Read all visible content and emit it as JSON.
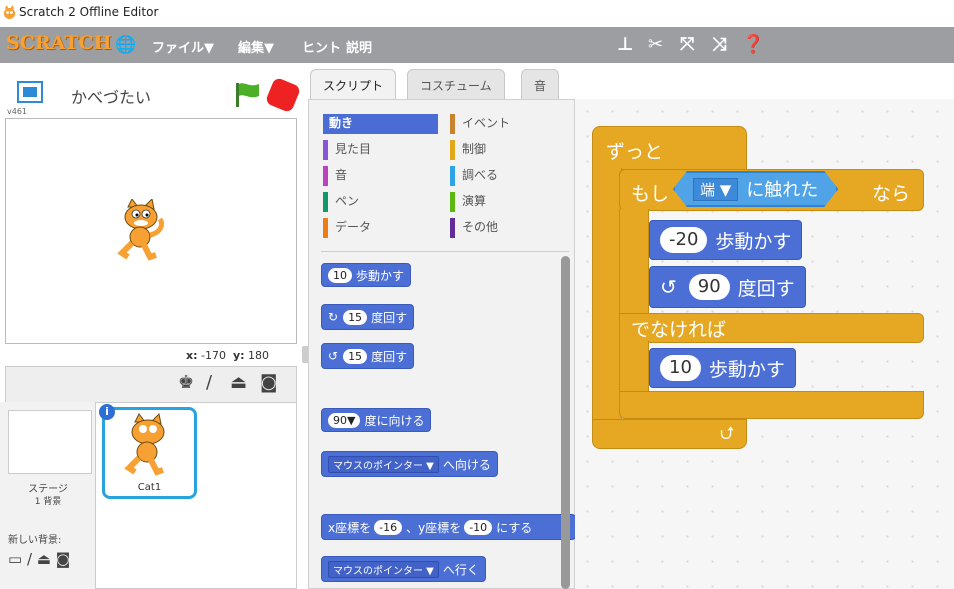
{
  "window": {
    "title": "Scratch 2 Offline Editor"
  },
  "menubar": {
    "logo": "SCRATCH",
    "file": "ファイル▼",
    "edit": "編集▼",
    "hint": "ヒント",
    "about": "説明"
  },
  "stage": {
    "project_name": "かべづたい",
    "version": "v461",
    "coords_x": "-170",
    "coords_y": "180",
    "x_label": "x:",
    "y_label": "y:"
  },
  "sprites": {
    "stage_label": "ステージ",
    "backdrop_count": "1 背景",
    "new_backdrop": "新しい背景:",
    "selected_sprite": "Cat1"
  },
  "tabs": [
    "スクリプト",
    "コスチューム",
    "音"
  ],
  "categories": {
    "left": [
      "動き",
      "見た目",
      "音",
      "ペン",
      "データ"
    ],
    "right": [
      "イベント",
      "制御",
      "調べる",
      "演算",
      "その他"
    ],
    "colors_left": [
      "#4a6cd4",
      "#8a55d7",
      "#bb42c3",
      "#0e9a6c",
      "#ee7d16"
    ],
    "colors_right": [
      "#c88330",
      "#e1a91a",
      "#2ca5e2",
      "#5cb712",
      "#632d99"
    ]
  },
  "palette_blocks": {
    "move": {
      "num": "10",
      "text": "歩動かす"
    },
    "turn_right": {
      "num": "15",
      "text": "度回す"
    },
    "turn_left": {
      "num": "15",
      "text": "度回す"
    },
    "point_dir": {
      "num": "90▼",
      "text": "度に向ける"
    },
    "point_towards": {
      "dd": "マウスのポインター ▼",
      "text": "へ向ける"
    },
    "goto_xy": {
      "t1": "x座標を",
      "n1": "-16",
      "t2": "、y座標を",
      "n2": "-10",
      "t3": "にする"
    },
    "goto": {
      "dd": "マウスのポインター ▼",
      "text": "へ行く"
    }
  },
  "script": {
    "forever": "ずっと",
    "if": "もし",
    "edge_dd": "端 ▼",
    "touching": "に触れた",
    "then": "なら",
    "move1_num": "-20",
    "move1_text": "歩動かす",
    "turn_num": "90",
    "turn_text": "度回す",
    "else": "でなければ",
    "move2_num": "10",
    "move2_text": "歩動かす"
  }
}
